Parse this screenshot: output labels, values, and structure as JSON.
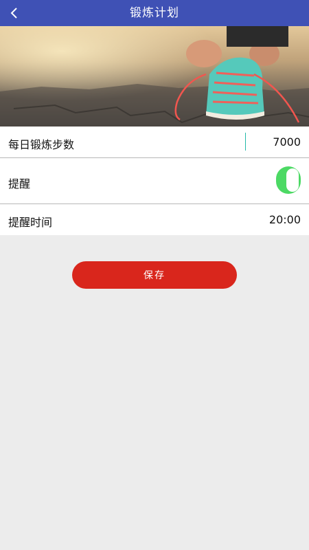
{
  "header": {
    "title": "锻炼计划",
    "back_icon": "chevron-left-icon",
    "color": "#3f51b5"
  },
  "hero": {
    "image": "running-shoe-lacing-photo"
  },
  "form": {
    "steps_label": "每日锻炼步数",
    "steps_value": "7000",
    "reminder_label": "提醒",
    "reminder_on": true,
    "time_label": "提醒时间",
    "time_value": "20:00"
  },
  "save_button": {
    "label": "保存",
    "color": "#d9261c"
  },
  "colors": {
    "toggle_on": "#4cd964",
    "background": "#ececec"
  }
}
